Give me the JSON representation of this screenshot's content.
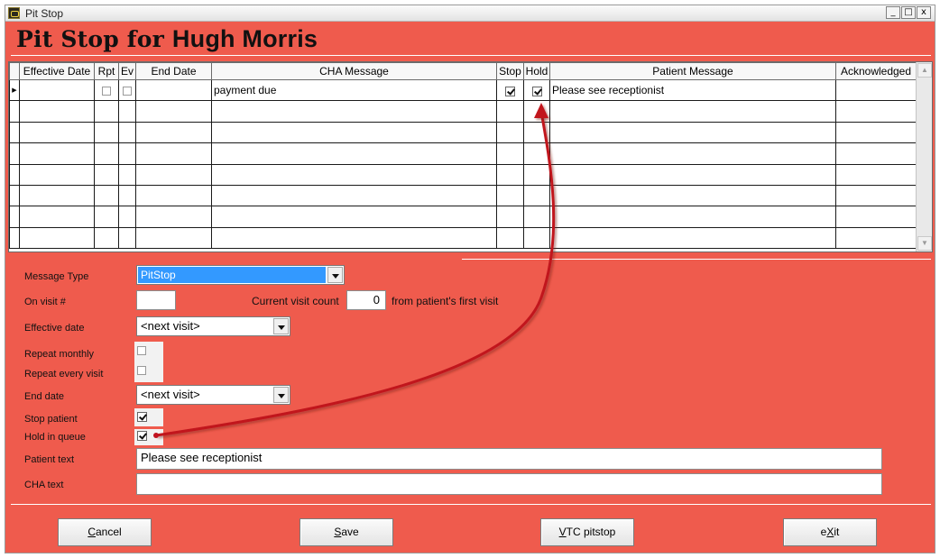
{
  "window": {
    "title": "Pit Stop",
    "controls": [
      "_",
      "□",
      "x"
    ]
  },
  "header": {
    "title_prefix": "Pit Stop for",
    "patient_name": "Hugh Morris"
  },
  "grid": {
    "columns": [
      "Effective Date",
      "Rpt",
      "Ev",
      "End Date",
      "CHA Message",
      "Stop",
      "Hold",
      "Patient Message",
      "Acknowledged"
    ],
    "rows": [
      {
        "effective_date": "",
        "rpt": false,
        "ev": false,
        "end_date": "",
        "cha_message": "payment due",
        "stop": true,
        "hold": true,
        "patient_message": "Please see receptionist",
        "acknowledged": ""
      }
    ],
    "empty_rows": 7
  },
  "form": {
    "message_type_label": "Message Type",
    "message_type_value": "PitStop",
    "on_visit_label": "On visit #",
    "on_visit_value": "",
    "current_visit_label": "Current visit count",
    "current_visit_value": "0",
    "from_first_visit_label": "from patient's first visit",
    "effective_date_label": "Effective date",
    "effective_date_value": "<next visit>",
    "repeat_monthly_label": "Repeat monthly",
    "repeat_monthly_checked": false,
    "repeat_every_visit_label": "Repeat every visit",
    "repeat_every_visit_checked": false,
    "end_date_label": "End date",
    "end_date_value": "<next visit>",
    "stop_patient_label": "Stop patient",
    "stop_patient_checked": true,
    "hold_in_queue_label": "Hold in queue",
    "hold_in_queue_checked": true,
    "patient_text_label": "Patient text",
    "patient_text_value": "Please see receptionist",
    "cha_text_label": "CHA text",
    "cha_text_value": ""
  },
  "buttons": {
    "cancel": {
      "pre": "",
      "u": "C",
      "post": "ancel"
    },
    "save": {
      "pre": "",
      "u": "S",
      "post": "ave"
    },
    "vtc": {
      "pre": "",
      "u": "V",
      "post": "TC pitstop"
    },
    "exit": {
      "pre": "e",
      "u": "X",
      "post": "it"
    }
  },
  "colors": {
    "window_bg": "#ef5b4d",
    "annotation_arrow": "#c1121f",
    "selection": "#3399ff"
  }
}
